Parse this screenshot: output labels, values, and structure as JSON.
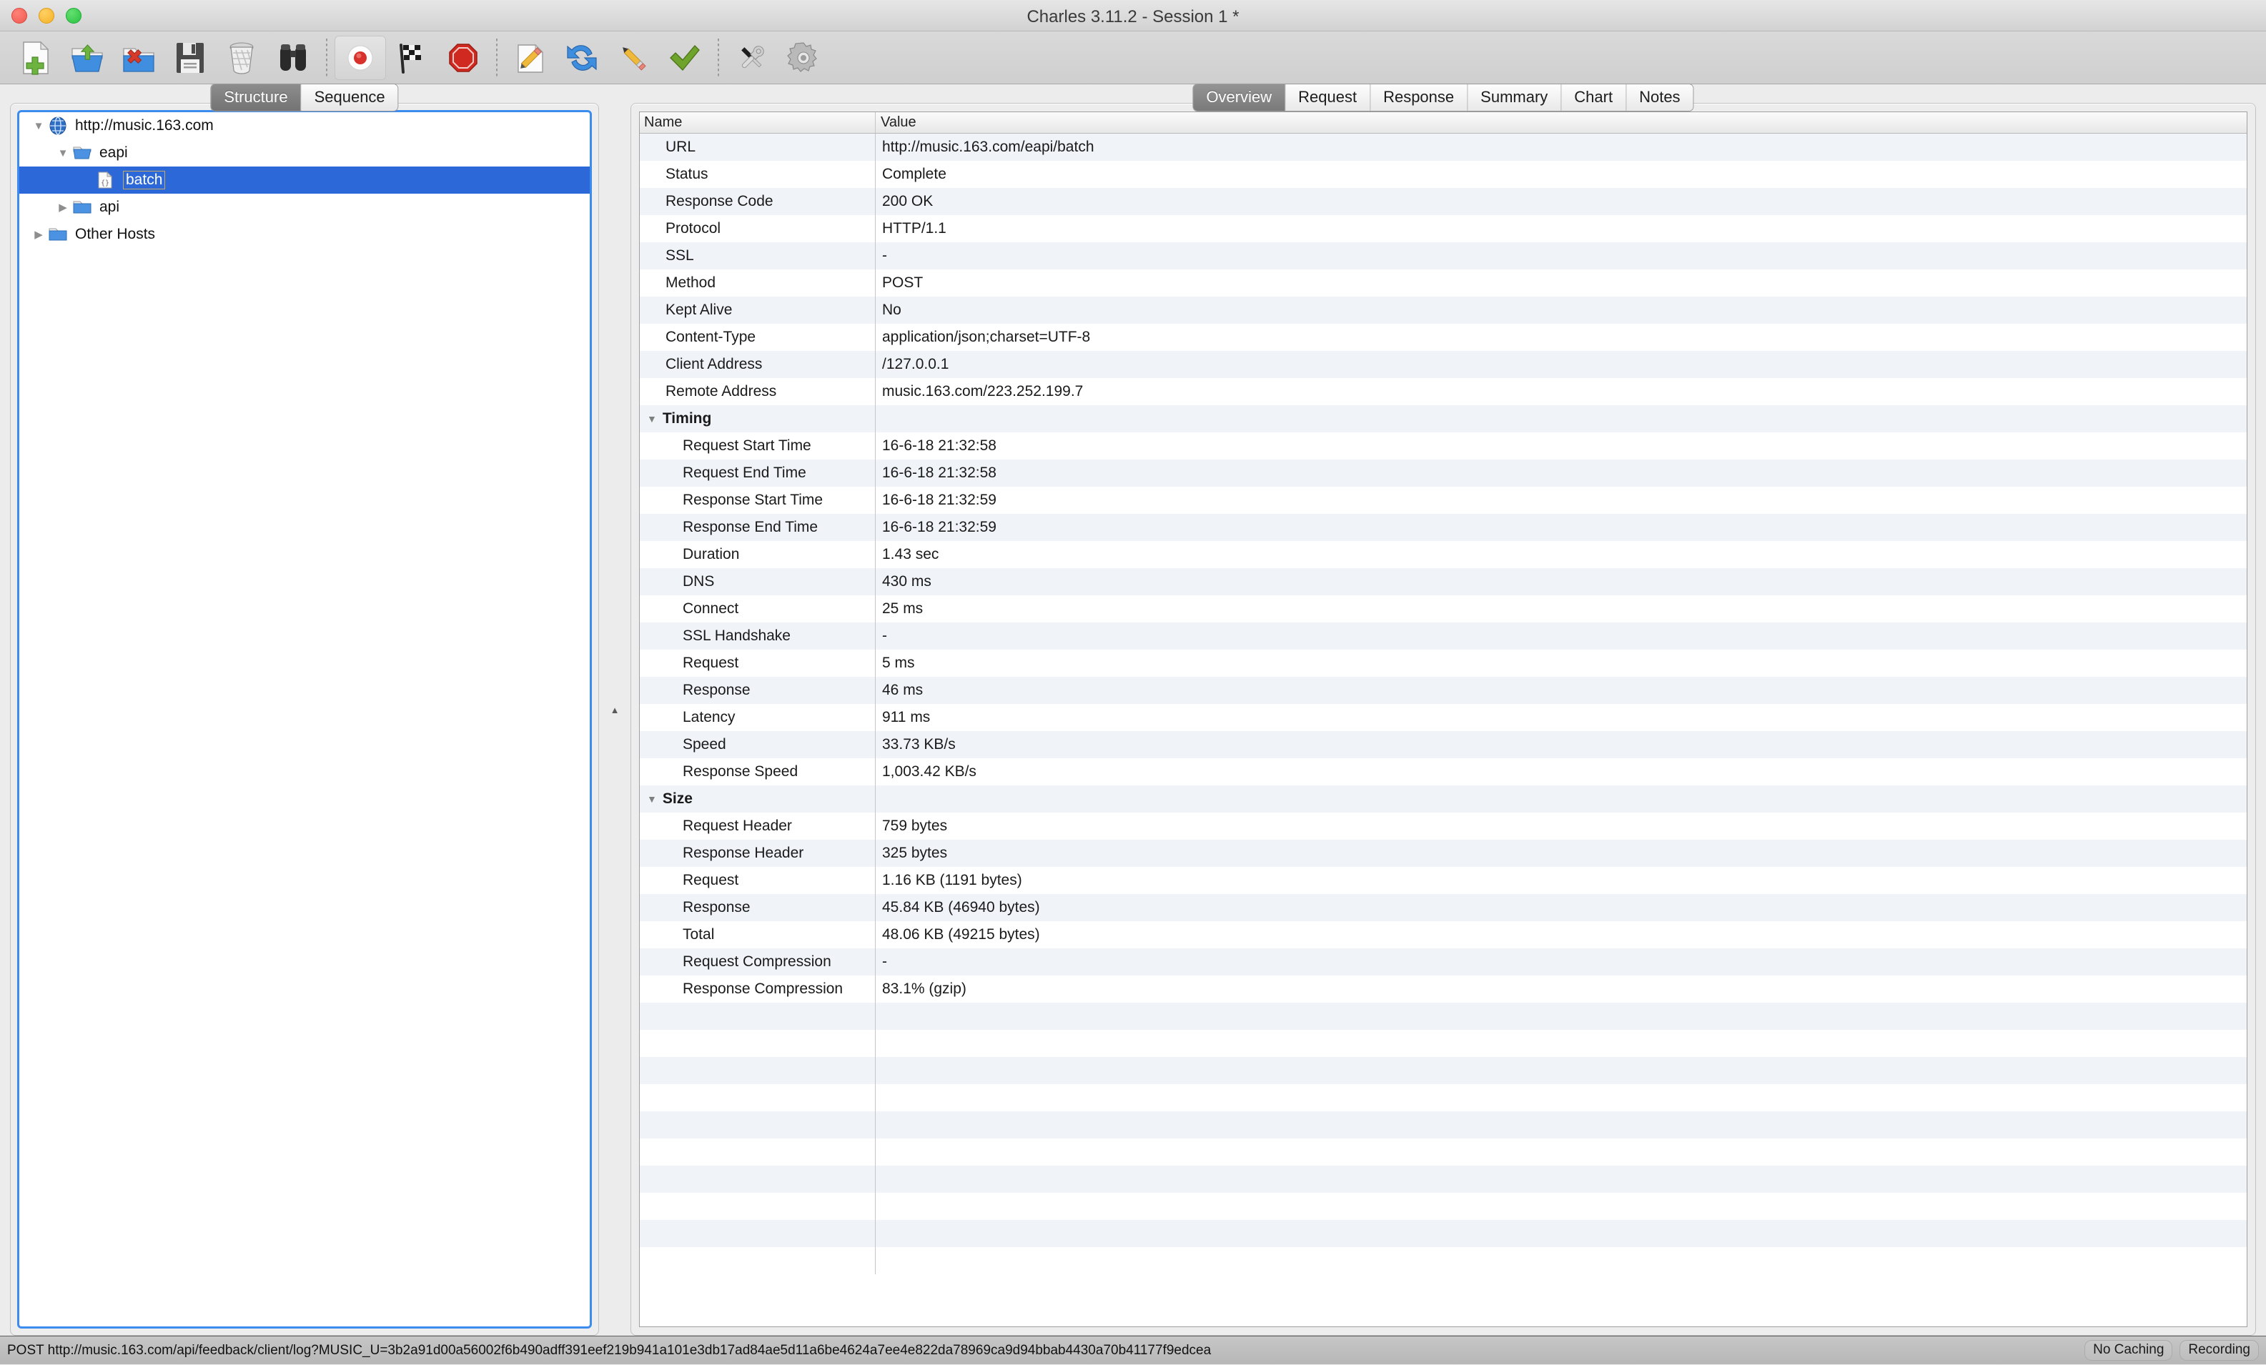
{
  "window": {
    "title": "Charles 3.11.2 - Session 1 *",
    "controls": [
      "close",
      "minimize",
      "zoom"
    ]
  },
  "toolbar": {
    "groups": [
      [
        {
          "name": "new-session-icon",
          "label": "New Session"
        },
        {
          "name": "open-session-icon",
          "label": "Open Session"
        },
        {
          "name": "close-session-icon",
          "label": "Close Session"
        },
        {
          "name": "save-session-icon",
          "label": "Save Session"
        },
        {
          "name": "clear-session-icon",
          "label": "Clear Session"
        },
        {
          "name": "find-icon",
          "label": "Find"
        }
      ],
      [
        {
          "name": "record-icon",
          "label": "Start/Stop Recording",
          "pressed": true
        },
        {
          "name": "throttle-icon",
          "label": "Throttle Settings"
        },
        {
          "name": "breakpoints-icon",
          "label": "Breakpoints"
        }
      ],
      [
        {
          "name": "compose-icon",
          "label": "Compose"
        },
        {
          "name": "repeat-icon",
          "label": "Repeat"
        },
        {
          "name": "edit-icon",
          "label": "Edit"
        },
        {
          "name": "validate-icon",
          "label": "Validate"
        }
      ],
      [
        {
          "name": "tools-icon",
          "label": "Tools"
        },
        {
          "name": "settings-icon",
          "label": "Settings"
        }
      ]
    ]
  },
  "left_pane": {
    "segmented": {
      "items": [
        {
          "label": "Structure",
          "active": true
        },
        {
          "label": "Sequence",
          "active": false
        }
      ]
    },
    "tree": [
      {
        "label": "http://music.163.com",
        "depth": 0,
        "twisty": "down",
        "icon": "host-globe-icon",
        "selected": false
      },
      {
        "label": "eapi",
        "depth": 1,
        "twisty": "down",
        "icon": "folder-icon",
        "selected": false
      },
      {
        "label": "batch",
        "depth": 2,
        "twisty": "none",
        "icon": "json-file-icon",
        "selected": true
      },
      {
        "label": "api",
        "depth": 1,
        "twisty": "right",
        "icon": "folder-icon",
        "selected": false
      },
      {
        "label": "Other Hosts",
        "depth": 0,
        "twisty": "right",
        "icon": "folder-icon",
        "selected": false
      }
    ]
  },
  "splitter": {
    "collapse_icon": "collapse-up-icon"
  },
  "right_pane": {
    "tabs": [
      {
        "label": "Overview",
        "active": true
      },
      {
        "label": "Request",
        "active": false
      },
      {
        "label": "Response",
        "active": false
      },
      {
        "label": "Summary",
        "active": false
      },
      {
        "label": "Chart",
        "active": false
      },
      {
        "label": "Notes",
        "active": false
      }
    ],
    "table": {
      "columns": [
        "Name",
        "Value"
      ],
      "rows": [
        {
          "type": "item",
          "name": "URL",
          "value": "http://music.163.com/eapi/batch"
        },
        {
          "type": "item",
          "name": "Status",
          "value": "Complete"
        },
        {
          "type": "item",
          "name": "Response Code",
          "value": "200 OK"
        },
        {
          "type": "item",
          "name": "Protocol",
          "value": "HTTP/1.1"
        },
        {
          "type": "item",
          "name": "SSL",
          "value": "-"
        },
        {
          "type": "item",
          "name": "Method",
          "value": "POST"
        },
        {
          "type": "item",
          "name": "Kept Alive",
          "value": "No"
        },
        {
          "type": "item",
          "name": "Content-Type",
          "value": "application/json;charset=UTF-8"
        },
        {
          "type": "item",
          "name": "Client Address",
          "value": "/127.0.0.1"
        },
        {
          "type": "item",
          "name": "Remote Address",
          "value": "music.163.com/223.252.199.7"
        },
        {
          "type": "group",
          "name": "Timing",
          "value": ""
        },
        {
          "type": "child",
          "name": "Request Start Time",
          "value": "16-6-18 21:32:58"
        },
        {
          "type": "child",
          "name": "Request End Time",
          "value": "16-6-18 21:32:58"
        },
        {
          "type": "child",
          "name": "Response Start Time",
          "value": "16-6-18 21:32:59"
        },
        {
          "type": "child",
          "name": "Response End Time",
          "value": "16-6-18 21:32:59"
        },
        {
          "type": "child",
          "name": "Duration",
          "value": "1.43 sec"
        },
        {
          "type": "child",
          "name": "DNS",
          "value": "430 ms"
        },
        {
          "type": "child",
          "name": "Connect",
          "value": "25 ms"
        },
        {
          "type": "child",
          "name": "SSL Handshake",
          "value": "-"
        },
        {
          "type": "child",
          "name": "Request",
          "value": "5 ms"
        },
        {
          "type": "child",
          "name": "Response",
          "value": "46 ms"
        },
        {
          "type": "child",
          "name": "Latency",
          "value": "911 ms"
        },
        {
          "type": "child",
          "name": "Speed",
          "value": "33.73 KB/s"
        },
        {
          "type": "child",
          "name": "Response Speed",
          "value": "1,003.42 KB/s"
        },
        {
          "type": "group",
          "name": "Size",
          "value": ""
        },
        {
          "type": "child",
          "name": "Request Header",
          "value": "759 bytes"
        },
        {
          "type": "child",
          "name": "Response Header",
          "value": "325 bytes"
        },
        {
          "type": "child",
          "name": "Request",
          "value": "1.16 KB (1191 bytes)"
        },
        {
          "type": "child",
          "name": "Response",
          "value": "45.84 KB (46940 bytes)"
        },
        {
          "type": "child",
          "name": "Total",
          "value": "48.06 KB (49215 bytes)"
        },
        {
          "type": "child",
          "name": "Request Compression",
          "value": "-"
        },
        {
          "type": "child",
          "name": "Response Compression",
          "value": "83.1% (gzip)"
        },
        {
          "type": "empty",
          "name": "",
          "value": ""
        },
        {
          "type": "empty",
          "name": "",
          "value": ""
        },
        {
          "type": "empty",
          "name": "",
          "value": ""
        },
        {
          "type": "empty",
          "name": "",
          "value": ""
        },
        {
          "type": "empty",
          "name": "",
          "value": ""
        },
        {
          "type": "empty",
          "name": "",
          "value": ""
        },
        {
          "type": "empty",
          "name": "",
          "value": ""
        },
        {
          "type": "empty",
          "name": "",
          "value": ""
        },
        {
          "type": "empty",
          "name": "",
          "value": ""
        },
        {
          "type": "empty",
          "name": "",
          "value": ""
        }
      ]
    }
  },
  "statusbar": {
    "url": "POST http://music.163.com/api/feedback/client/log?MUSIC_U=3b2a91d00a56002f6b490adff391eef219b941a101e3db17ad84ae5d11a6be4624a7ee4e822da78969ca9d94bbab4430a70b41177f9edcea",
    "pills": [
      {
        "label": "No Caching",
        "name": "no-caching-indicator"
      },
      {
        "label": "Recording",
        "name": "recording-indicator"
      }
    ]
  },
  "colors": {
    "selection_blue": "#2d68d8",
    "focus_ring": "#3c8cf0",
    "row_alt": "#f0f4f8",
    "window_chrome": "#d2d2d2"
  }
}
